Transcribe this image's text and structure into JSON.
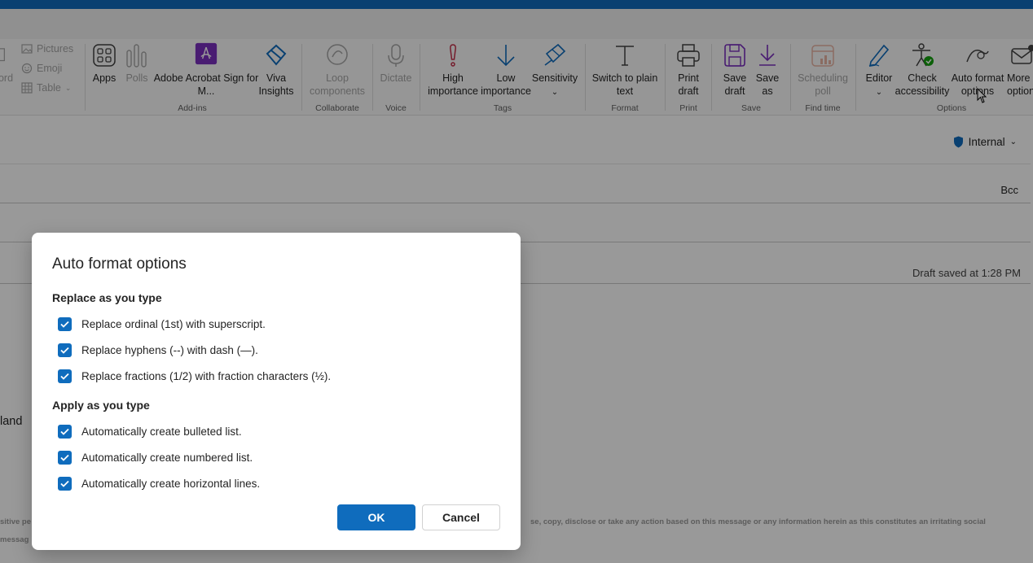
{
  "ribbon": {
    "left_partial": {
      "label": "ord",
      "pictures": "Pictures",
      "emoji": "Emoji",
      "table": "Table"
    },
    "addins": {
      "apps": "Apps",
      "polls": "Polls",
      "acrobat_line1": "Adobe Acrobat Sign for",
      "acrobat_line2": "M...",
      "viva_line1": "Viva",
      "viva_line2": "Insights",
      "group": "Add-ins"
    },
    "collaborate": {
      "loop_line1": "Loop",
      "loop_line2": "components",
      "group": "Collaborate"
    },
    "voice": {
      "dictate": "Dictate",
      "group": "Voice"
    },
    "tags": {
      "high_line1": "High",
      "high_line2": "importance",
      "low_line1": "Low",
      "low_line2": "importance",
      "sensitivity": "Sensitivity",
      "group": "Tags"
    },
    "format": {
      "plain_line1": "Switch to plain",
      "plain_line2": "text",
      "group": "Format"
    },
    "print": {
      "line1": "Print",
      "line2": "draft",
      "group": "Print"
    },
    "save": {
      "draft_line1": "Save",
      "draft_line2": "draft",
      "as_line1": "Save",
      "as_line2": "as",
      "group": "Save"
    },
    "findtime": {
      "line1": "Scheduling",
      "line2": "poll",
      "group": "Find time"
    },
    "options": {
      "editor": "Editor",
      "check_line1": "Check",
      "check_line2": "accessibility",
      "auto_line1": "Auto format",
      "auto_line2": "options",
      "more_line1": "More",
      "more_line2": "options",
      "group": "Options"
    }
  },
  "compose": {
    "sensitivity_label": "Internal",
    "bcc": "Bcc",
    "draft_status": "Draft saved at 1:28 PM",
    "body_fragment": "land",
    "disclaimer_left1": "sitive pe",
    "disclaimer_left2": "messag",
    "disclaimer_right": "se, copy, disclose or take any action based on this message or any information herein as this constitutes an irritating social"
  },
  "dialog": {
    "title": "Auto format options",
    "section_replace": "Replace as you type",
    "replace_options": [
      {
        "label": "Replace ordinal (1st) with superscript.",
        "checked": true
      },
      {
        "label": "Replace hyphens (--) with dash (—).",
        "checked": true
      },
      {
        "label": "Replace fractions (1/2) with fraction characters (½).",
        "checked": true
      }
    ],
    "section_apply": "Apply as you type",
    "apply_options": [
      {
        "label": "Automatically create bulleted list.",
        "checked": true
      },
      {
        "label": "Automatically create numbered list.",
        "checked": true
      },
      {
        "label": "Automatically create horizontal lines.",
        "checked": true
      }
    ],
    "ok": "OK",
    "cancel": "Cancel"
  },
  "colors": {
    "accent": "#0f6cbd",
    "purple": "#7b2fbe",
    "disabled": "#a6a6a6"
  }
}
